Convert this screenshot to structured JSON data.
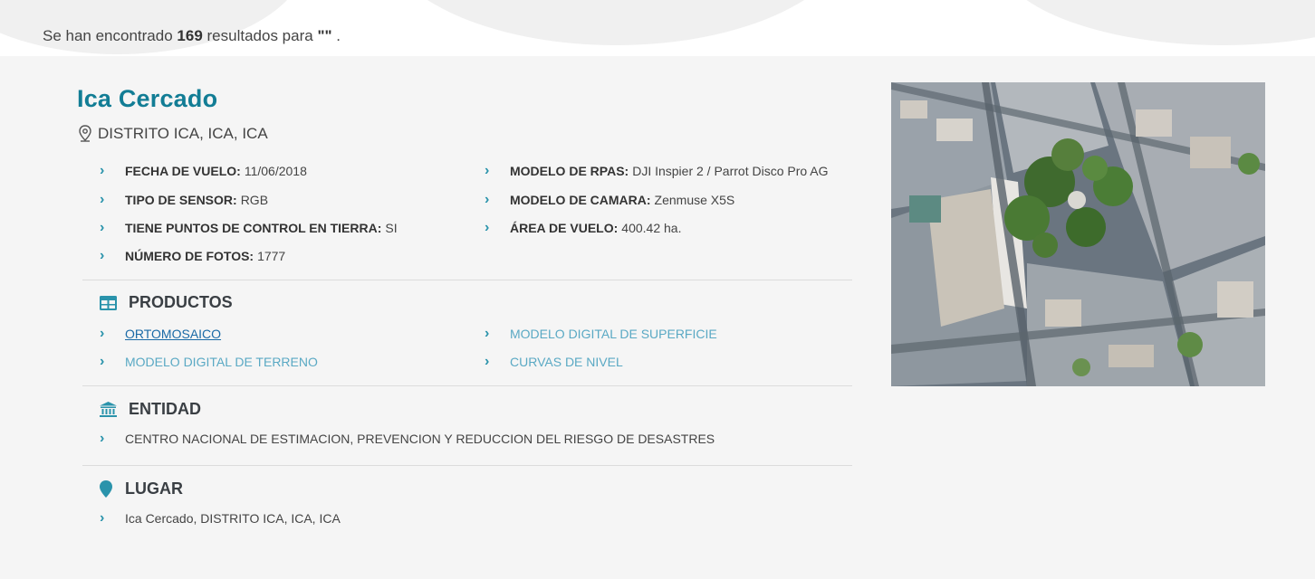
{
  "results": {
    "prefix": "Se han encontrado",
    "count": "169",
    "middle": "resultados para",
    "query": "\"\"",
    "suffix": "."
  },
  "project": {
    "title": "Ica Cercado",
    "location": "DISTRITO ICA, ICA, ICA",
    "details": [
      {
        "label": "FECHA DE VUELO:",
        "value": "11/06/2018"
      },
      {
        "label": "MODELO DE RPAS:",
        "value": "DJI Inspier 2 / Parrot Disco Pro AG"
      },
      {
        "label": "TIPO DE SENSOR:",
        "value": "RGB"
      },
      {
        "label": "MODELO DE CAMARA:",
        "value": "Zenmuse X5S"
      },
      {
        "label": "TIENE PUNTOS DE CONTROL EN TIERRA:",
        "value": "SI"
      },
      {
        "label": "ÁREA DE VUELO:",
        "value": "400.42 ha."
      },
      {
        "label": "NÚMERO DE FOTOS:",
        "value": "1777"
      }
    ]
  },
  "productos": {
    "heading": "PRODUCTOS",
    "icon": "table-icon",
    "items": [
      "ORTOMOSAICO",
      "MODELO DIGITAL DE SUPERFICIE",
      "MODELO DIGITAL DE TERRENO",
      "CURVAS DE NIVEL"
    ]
  },
  "entidad": {
    "heading": "ENTIDAD",
    "icon": "institution-icon",
    "value": "CENTRO NACIONAL DE ESTIMACION, PREVENCION Y REDUCCION DEL RIESGO DE DESASTRES"
  },
  "lugar": {
    "heading": "LUGAR",
    "icon": "map-pin-icon",
    "value": "Ica Cercado, DISTRITO ICA, ICA, ICA"
  },
  "colors": {
    "title": "#127d95",
    "accent": "#2a93ab",
    "link": "#5aa9c4",
    "link_active": "#1a6aa6"
  }
}
